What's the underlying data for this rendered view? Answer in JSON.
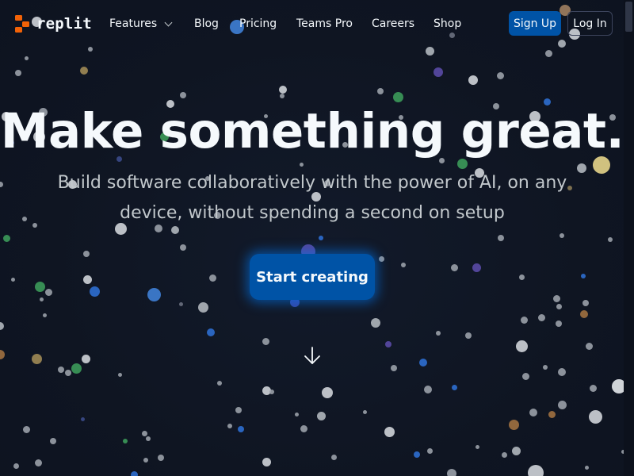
{
  "header": {
    "logo_text": "replit",
    "logo_color": "#f26207",
    "nav": [
      {
        "label": "Features",
        "has_dropdown": true
      },
      {
        "label": "Blog"
      },
      {
        "label": "Pricing"
      },
      {
        "label": "Teams Pro"
      },
      {
        "label": "Careers"
      },
      {
        "label": "Shop"
      }
    ],
    "signup_label": "Sign Up",
    "login_label": "Log In"
  },
  "hero": {
    "title": "Make something great.",
    "subtitle_line1": "Build software collaboratively with the power of AI, on any",
    "subtitle_line2": "device, without spending a second on setup",
    "cta_label": "Start creating",
    "scroll_icon": "arrow-down-icon"
  },
  "colors": {
    "background": "#0f1522",
    "primary_button": "#0053a6",
    "text": "#f5f9fc",
    "subtext": "#c2c8cc"
  }
}
